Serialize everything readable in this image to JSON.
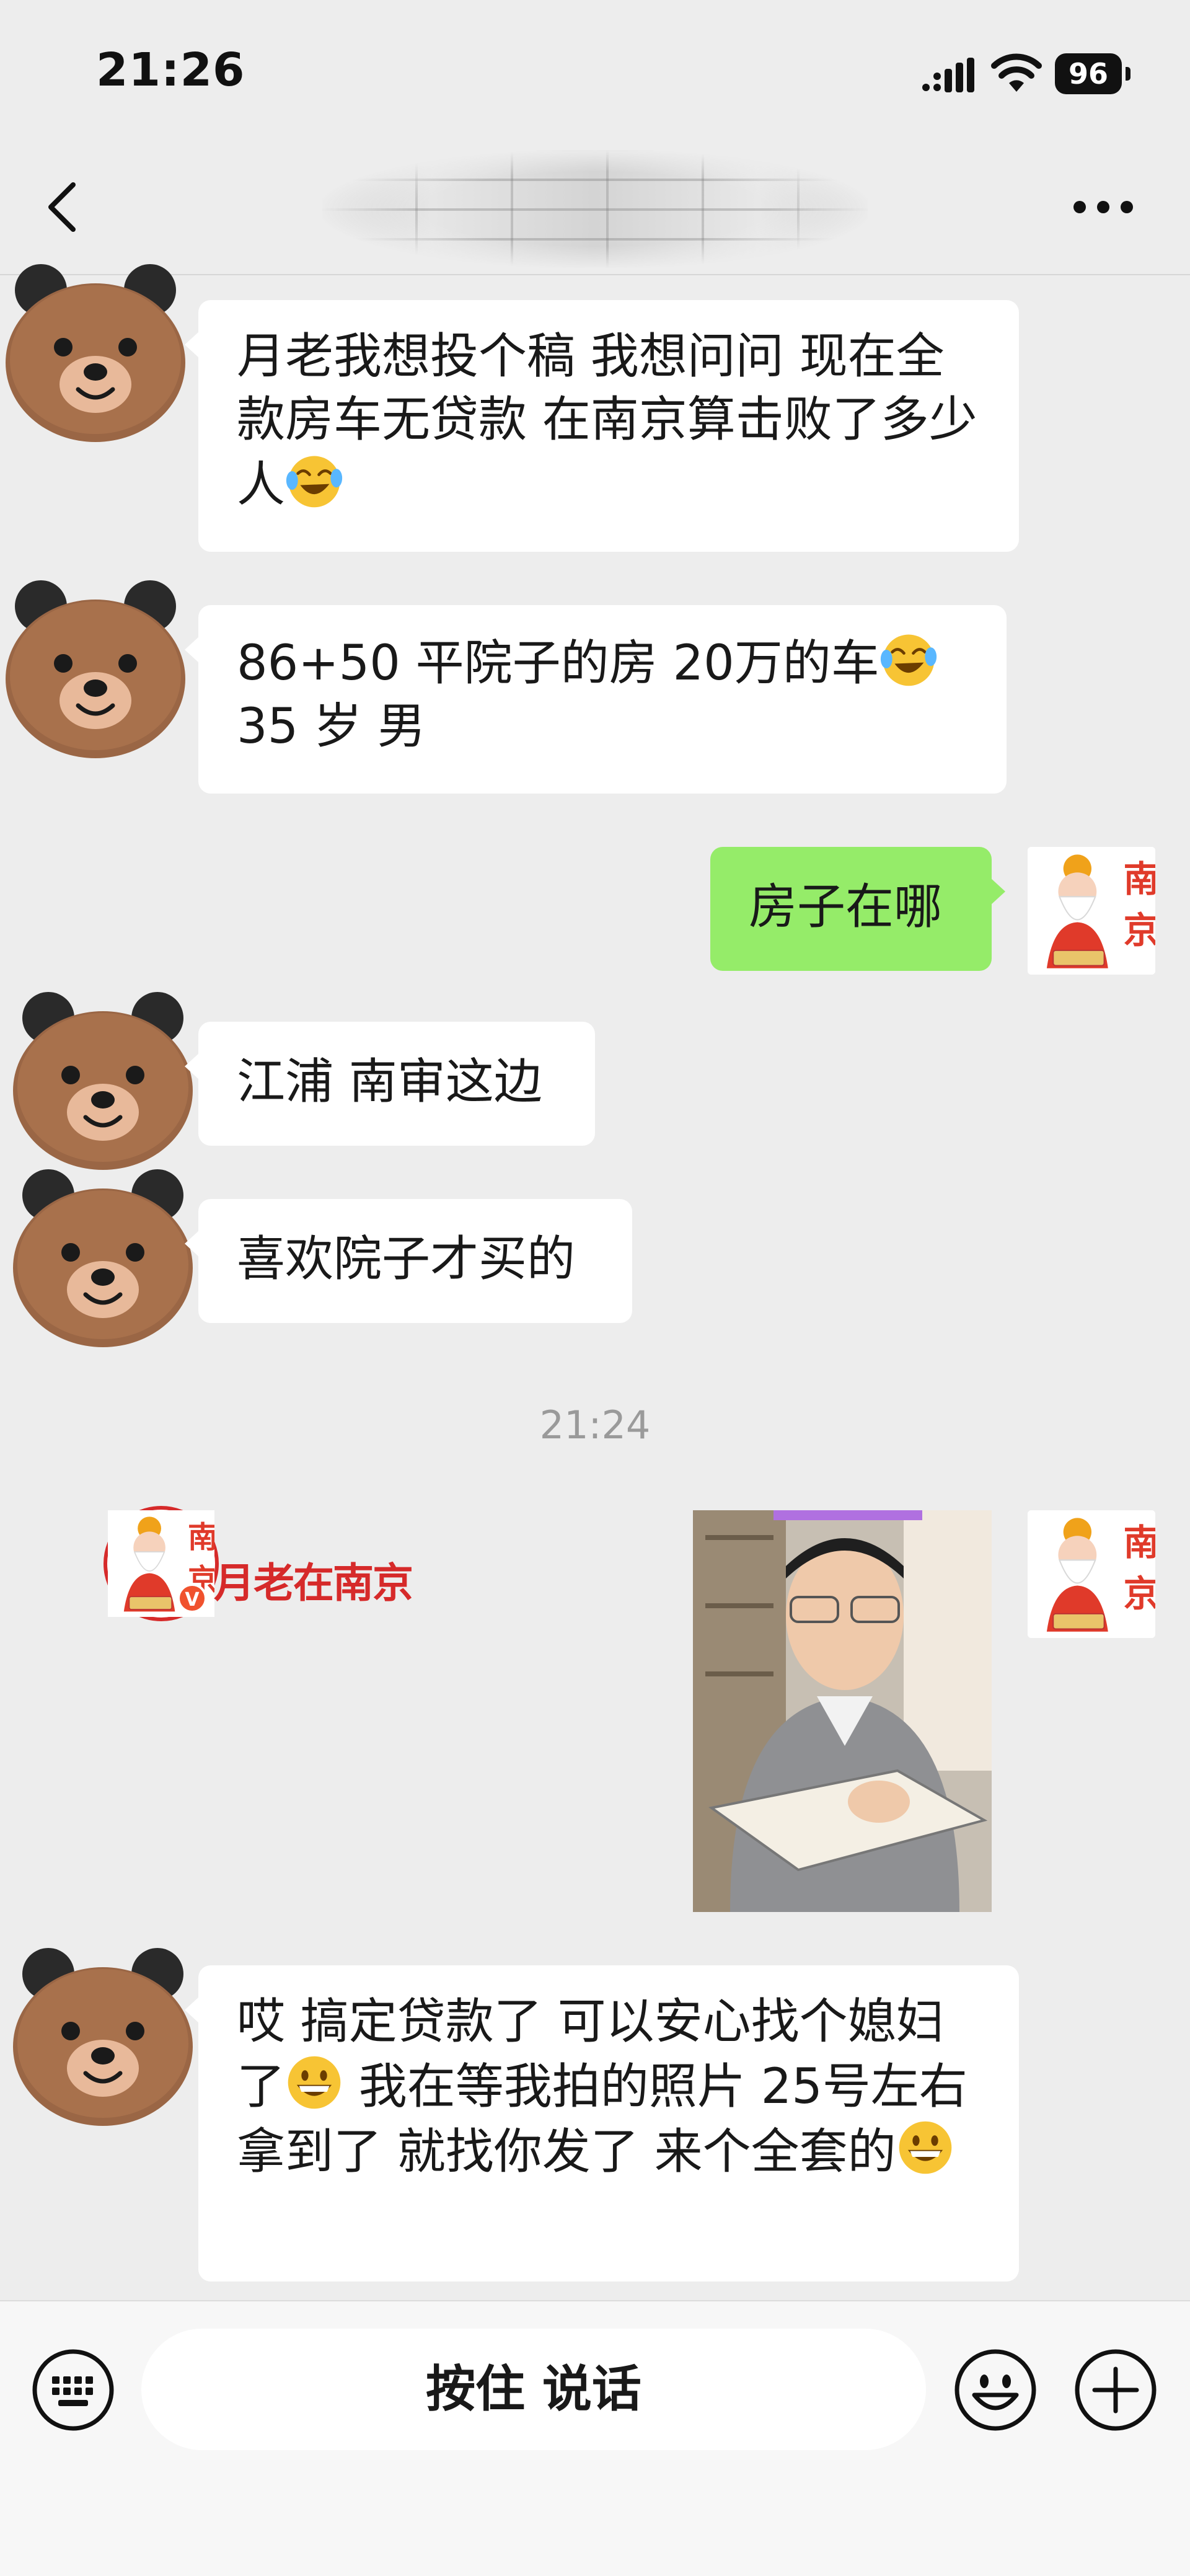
{
  "status_bar": {
    "time": "21:26",
    "battery": "96"
  },
  "nav": {
    "back_icon": "chevron-left-icon",
    "more_icon": "more-dots-icon"
  },
  "messages": [
    {
      "side": "left",
      "text": "月老我想投个稿 我想问问 现在全款房车无贷款 在南京算击败了多少人",
      "emoji_after": "crying-laughing-emoji"
    },
    {
      "side": "left",
      "line1": "86+50 平院子的房 20万的车",
      "emoji_after": "crying-laughing-emoji",
      "line2": "35 岁 男"
    },
    {
      "side": "right",
      "text": "房子在哪"
    },
    {
      "side": "left",
      "text": "江浦 南审这边"
    },
    {
      "side": "left",
      "text": "喜欢院子才买的"
    },
    {
      "side": "left",
      "part1": "哎 搞定贷款了 可以安心找个媳妇了",
      "part2": " 我在等我拍的照片 25号左右拿到了 就找你发了 来个全套的",
      "emoji": "grinning-emoji"
    }
  ],
  "timestamp": "21:24",
  "shared_video": {
    "channel_name": "月老在南京",
    "logo_text": "南京",
    "verified": "V"
  },
  "input_bar": {
    "voice_label": "按住 说话",
    "keyboard_icon": "keyboard-icon",
    "emoji_icon": "smiley-icon",
    "plus_icon": "plus-icon"
  },
  "colors": {
    "background": "#ededed",
    "bubble_left": "#ffffff",
    "bubble_right": "#95ec69",
    "brand_red": "#d62a2a"
  }
}
